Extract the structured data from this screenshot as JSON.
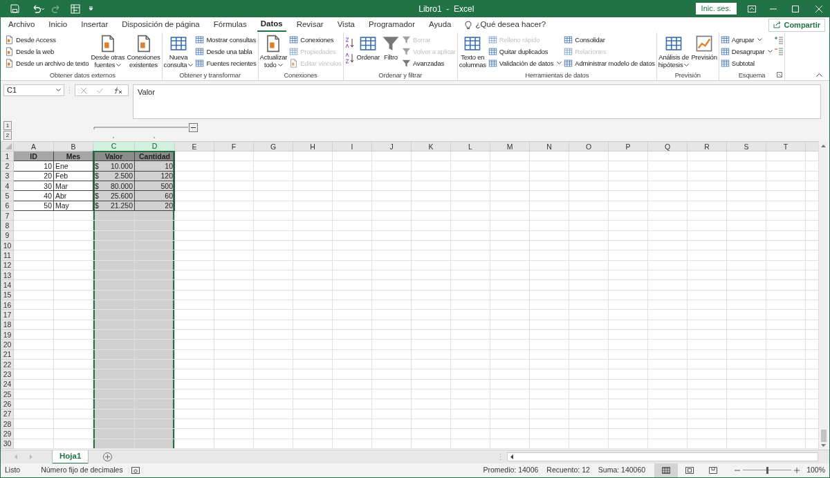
{
  "title_bar": {
    "title": "Libro1  -  Excel",
    "sign_in": "Inic. ses."
  },
  "menu_tabs": [
    {
      "label": "Archivo",
      "selected": false
    },
    {
      "label": "Inicio",
      "selected": false
    },
    {
      "label": "Insertar",
      "selected": false
    },
    {
      "label": "Disposición de página",
      "selected": false
    },
    {
      "label": "Fórmulas",
      "selected": false
    },
    {
      "label": "Datos",
      "selected": true
    },
    {
      "label": "Revisar",
      "selected": false
    },
    {
      "label": "Vista",
      "selected": false
    },
    {
      "label": "Programador",
      "selected": false
    },
    {
      "label": "Ayuda",
      "selected": false
    }
  ],
  "search": {
    "placeholder": "¿Qué desea hacer?"
  },
  "share": "Compartir",
  "ribbon_groups": [
    {
      "label": "Obtener datos externos",
      "columns": [
        {
          "kind": "stack",
          "items": [
            {
              "label": "Desde Access",
              "disabled": false,
              "dropdown": false
            },
            {
              "label": "Desde la web",
              "disabled": false,
              "dropdown": false
            },
            {
              "label": "Desde un archivo de texto",
              "disabled": false,
              "dropdown": false
            }
          ]
        },
        {
          "kind": "large",
          "items": [
            {
              "label": "Desde otras\nfuentes",
              "disabled": false,
              "dropdown": true
            }
          ]
        },
        {
          "kind": "large",
          "items": [
            {
              "label": "Conexiones\nexistentes",
              "disabled": false,
              "dropdown": false
            }
          ]
        }
      ]
    },
    {
      "label": "Obtener y transformar",
      "columns": [
        {
          "kind": "large",
          "items": [
            {
              "label": "Nueva\nconsulta",
              "disabled": false,
              "dropdown": true
            }
          ]
        },
        {
          "kind": "stack",
          "items": [
            {
              "label": "Mostrar consultas",
              "disabled": false,
              "dropdown": false
            },
            {
              "label": "Desde una tabla",
              "disabled": false,
              "dropdown": false
            },
            {
              "label": "Fuentes recientes",
              "disabled": false,
              "dropdown": false
            }
          ]
        }
      ]
    },
    {
      "label": "Conexiones",
      "columns": [
        {
          "kind": "large",
          "items": [
            {
              "label": "Actualizar\ntodo",
              "disabled": false,
              "dropdown": true
            }
          ]
        },
        {
          "kind": "stack",
          "items": [
            {
              "label": "Conexiones",
              "disabled": false,
              "dropdown": false
            },
            {
              "label": "Propiedades",
              "disabled": true,
              "dropdown": false
            },
            {
              "label": "Editar vínculos",
              "disabled": true,
              "dropdown": false
            }
          ]
        }
      ]
    },
    {
      "label": "Ordenar y filtrar",
      "columns": [
        {
          "kind": "sort-icons"
        },
        {
          "kind": "large",
          "items": [
            {
              "label": "Ordenar",
              "disabled": false,
              "dropdown": false
            }
          ]
        },
        {
          "kind": "large",
          "items": [
            {
              "label": "Filtro",
              "disabled": false,
              "dropdown": false
            }
          ]
        },
        {
          "kind": "stack",
          "items": [
            {
              "label": "Borrar",
              "disabled": true,
              "dropdown": false
            },
            {
              "label": "Volver a aplicar",
              "disabled": true,
              "dropdown": false
            },
            {
              "label": "Avanzadas",
              "disabled": false,
              "dropdown": false
            }
          ]
        }
      ]
    },
    {
      "label": "Herramientas de datos",
      "columns": [
        {
          "kind": "large",
          "items": [
            {
              "label": "Texto en\ncolumnas",
              "disabled": false,
              "dropdown": false
            }
          ]
        },
        {
          "kind": "stack",
          "items": [
            {
              "label": "Relleno rápido",
              "disabled": true,
              "dropdown": false
            },
            {
              "label": "Quitar duplicados",
              "disabled": false,
              "dropdown": false
            },
            {
              "label": "Validación de datos",
              "disabled": false,
              "dropdown": true
            }
          ]
        },
        {
          "kind": "stack",
          "items": [
            {
              "label": "Consolidar",
              "disabled": false,
              "dropdown": false
            },
            {
              "label": "Relaciones",
              "disabled": true,
              "dropdown": false
            },
            {
              "label": "Administrar modelo de datos",
              "disabled": false,
              "dropdown": false
            }
          ]
        }
      ]
    },
    {
      "label": "Previsión",
      "columns": [
        {
          "kind": "large",
          "items": [
            {
              "label": "Análisis de\nhipótesis",
              "disabled": false,
              "dropdown": true
            }
          ]
        },
        {
          "kind": "large",
          "items": [
            {
              "label": "Previsión",
              "disabled": false,
              "dropdown": false
            }
          ]
        }
      ]
    },
    {
      "label": "Esquema",
      "columns": [
        {
          "kind": "stack",
          "items": [
            {
              "label": "Agrupar",
              "disabled": false,
              "dropdown": true
            },
            {
              "label": "Desagrupar",
              "disabled": false,
              "dropdown": true
            },
            {
              "label": "Subtotal",
              "disabled": false,
              "dropdown": false
            }
          ]
        },
        {
          "kind": "outline-icons"
        }
      ]
    }
  ],
  "formula_bar": {
    "name_box": "C1",
    "formula": "Valor"
  },
  "outline_levels": [
    "1",
    "2"
  ],
  "columns": [
    {
      "letter": "A",
      "selected": false
    },
    {
      "letter": "B",
      "selected": false
    },
    {
      "letter": "C",
      "selected": true
    },
    {
      "letter": "D",
      "selected": true
    },
    {
      "letter": "E",
      "selected": false
    },
    {
      "letter": "F",
      "selected": false
    },
    {
      "letter": "G",
      "selected": false
    },
    {
      "letter": "H",
      "selected": false
    },
    {
      "letter": "I",
      "selected": false
    },
    {
      "letter": "J",
      "selected": false
    },
    {
      "letter": "K",
      "selected": false
    },
    {
      "letter": "L",
      "selected": false
    },
    {
      "letter": "M",
      "selected": false
    },
    {
      "letter": "N",
      "selected": false
    },
    {
      "letter": "O",
      "selected": false
    },
    {
      "letter": "P",
      "selected": false
    },
    {
      "letter": "Q",
      "selected": false
    },
    {
      "letter": "R",
      "selected": false
    },
    {
      "letter": "S",
      "selected": false
    },
    {
      "letter": "T",
      "selected": false
    }
  ],
  "row_numbers": [
    "1",
    "2",
    "3",
    "4",
    "5",
    "6",
    "7",
    "8",
    "9",
    "10",
    "11",
    "12",
    "13",
    "14",
    "15",
    "16",
    "17",
    "18",
    "19",
    "20",
    "21",
    "22",
    "23",
    "24",
    "25",
    "26",
    "27",
    "28",
    "29",
    "30"
  ],
  "rows": [
    {
      "kind": "header",
      "cells": [
        {
          "kind": "header",
          "text": "ID"
        },
        {
          "kind": "header",
          "text": "Mes"
        },
        {
          "kind": "header",
          "text": "Valor"
        },
        {
          "kind": "header",
          "text": "Cantidad"
        }
      ]
    },
    {
      "kind": "data",
      "cells": [
        {
          "kind": "number",
          "text": "10"
        },
        {
          "kind": "text",
          "text": "Ene"
        },
        {
          "kind": "currency",
          "currency": "$",
          "text": "10.000"
        },
        {
          "kind": "number",
          "text": "10"
        }
      ]
    },
    {
      "kind": "data",
      "cells": [
        {
          "kind": "number",
          "text": "20"
        },
        {
          "kind": "text",
          "text": "Feb"
        },
        {
          "kind": "currency",
          "currency": "$",
          "text": "2.500"
        },
        {
          "kind": "number",
          "text": "120"
        }
      ]
    },
    {
      "kind": "data",
      "cells": [
        {
          "kind": "number",
          "text": "30"
        },
        {
          "kind": "text",
          "text": "Mar"
        },
        {
          "kind": "currency",
          "currency": "$",
          "text": "80.000"
        },
        {
          "kind": "number",
          "text": "500"
        }
      ]
    },
    {
      "kind": "data",
      "cells": [
        {
          "kind": "number",
          "text": "40"
        },
        {
          "kind": "text",
          "text": "Abr"
        },
        {
          "kind": "currency",
          "currency": "$",
          "text": "25.600"
        },
        {
          "kind": "number",
          "text": "60"
        }
      ]
    },
    {
      "kind": "data",
      "cells": [
        {
          "kind": "number",
          "text": "50"
        },
        {
          "kind": "text",
          "text": "May"
        },
        {
          "kind": "currency",
          "currency": "$",
          "text": "21.250"
        },
        {
          "kind": "number",
          "text": "20"
        }
      ]
    }
  ],
  "sheet_tabs": [
    {
      "label": "Hoja1",
      "selected": true
    }
  ],
  "status_bar": {
    "mode": "Listo",
    "fixed_decimal": "Número fijo de decimales",
    "average": "Promedio: 14006",
    "count": "Recuento: 12",
    "sum": "Suma: 140060",
    "views": [
      {
        "selected": true
      },
      {
        "selected": false
      },
      {
        "selected": false
      }
    ],
    "zoom_slider": {
      "level": 0.5
    },
    "zoom": "100%"
  }
}
